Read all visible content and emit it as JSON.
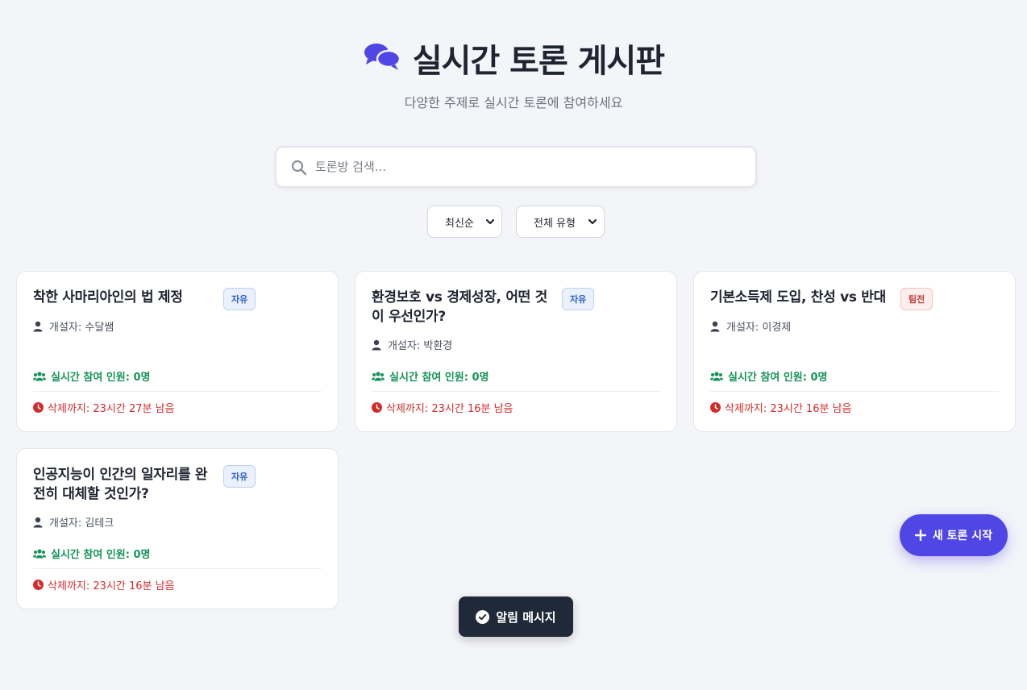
{
  "header": {
    "title": "실시간 토론 게시판",
    "subtitle": "다양한 주제로 실시간 토론에 참여하세요"
  },
  "search": {
    "placeholder": "토론방 검색..."
  },
  "filters": {
    "sort_selected": "최신순",
    "type_selected": "전체 유형"
  },
  "cards": [
    {
      "title": "착한 사마리아인의 법 제정",
      "badge": "자유",
      "creator": "개설자: 수달쌤",
      "live": "실시간 참여 인원: 0명",
      "expire": "삭제까지: 23시간 27분 남음"
    },
    {
      "title": "환경보호 vs 경제성장, 어떤 것이 우선인가?",
      "badge": "자유",
      "creator": "개설자: 박환경",
      "live": "실시간 참여 인원: 0명",
      "expire": "삭제까지: 23시간 16분 남음"
    },
    {
      "title": "기본소득제 도입, 찬성 vs 반대",
      "badge": "팀전",
      "creator": "개설자: 이경제",
      "live": "실시간 참여 인원: 0명",
      "expire": "삭제까지: 23시간 16분 남음"
    },
    {
      "title": "인공지능이 인간의 일자리를 완전히 대체할 것인가?",
      "badge": "자유",
      "creator": "개설자: 김테크",
      "live": "실시간 참여 인원: 0명",
      "expire": "삭제까지: 23시간 16분 남음"
    }
  ],
  "fab": {
    "label": "새 토론 시작"
  },
  "toast": {
    "message": "알림 메시지"
  },
  "colors": {
    "accent": "#4f46e5",
    "live": "#15925a",
    "expire": "#d42a2a"
  }
}
